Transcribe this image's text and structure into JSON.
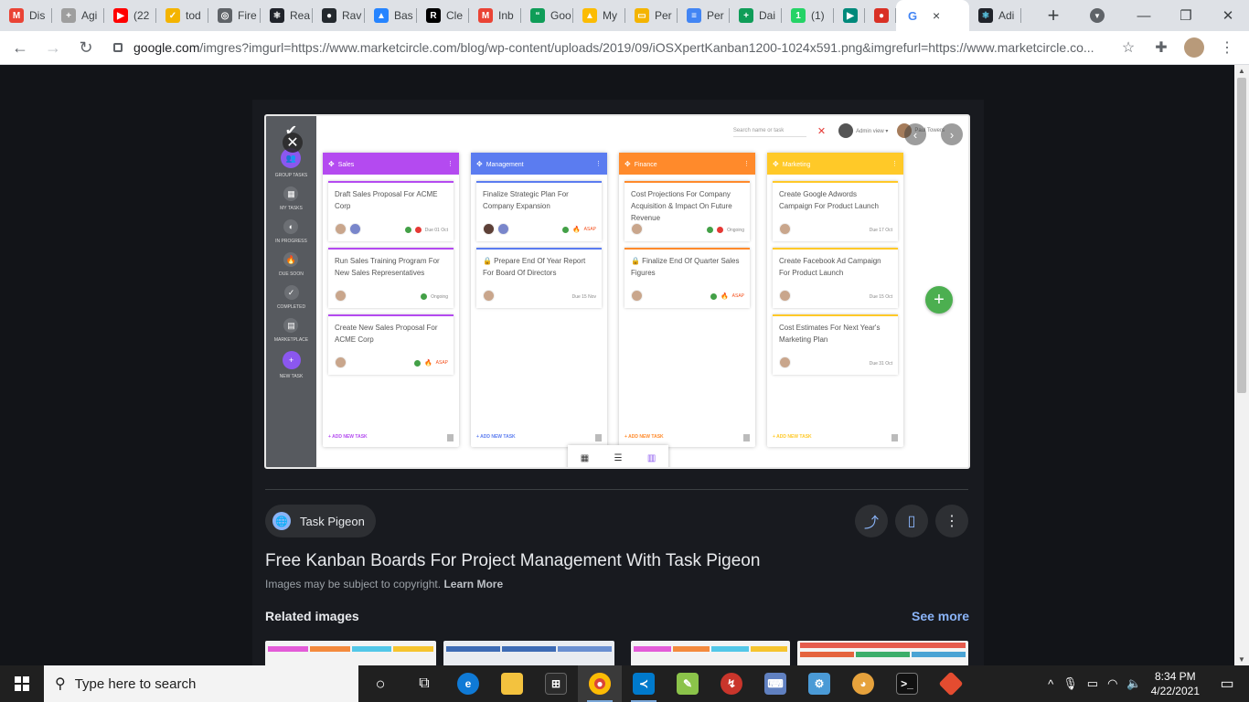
{
  "tabs": [
    {
      "label": "Dis",
      "icon": "gmail-icon",
      "color": "#ea4335",
      "glyph": "M"
    },
    {
      "label": "Agi",
      "icon": "agile-icon",
      "color": "#9e9e9e",
      "glyph": "+"
    },
    {
      "label": "(22",
      "icon": "youtube-icon",
      "color": "#ff0000",
      "glyph": "▶"
    },
    {
      "label": "tod",
      "icon": "todo-icon",
      "color": "#f4b400",
      "glyph": "✓"
    },
    {
      "label": "Fire",
      "icon": "globe-icon",
      "color": "#5f6368",
      "glyph": "◎"
    },
    {
      "label": "Rea",
      "icon": "react-icon",
      "color": "#20232a",
      "glyph": "⚛"
    },
    {
      "label": "Rav",
      "icon": "github-icon",
      "color": "#24292e",
      "glyph": "●"
    },
    {
      "label": "Bas",
      "icon": "atlassian-icon",
      "color": "#2684ff",
      "glyph": "▲"
    },
    {
      "label": "Cle",
      "icon": "replit-icon",
      "color": "#000000",
      "glyph": "R"
    },
    {
      "label": "Inb",
      "icon": "gmail-icon",
      "color": "#ea4335",
      "glyph": "M"
    },
    {
      "label": "Goo",
      "icon": "chat-icon",
      "color": "#0f9d58",
      "glyph": "“"
    },
    {
      "label": "My",
      "icon": "drive-icon",
      "color": "#fbbc04",
      "glyph": "▲"
    },
    {
      "label": "Per",
      "icon": "slides-icon",
      "color": "#f4b400",
      "glyph": "▭"
    },
    {
      "label": "Per",
      "icon": "docs-icon",
      "color": "#4285f4",
      "glyph": "≡"
    },
    {
      "label": "Dai",
      "icon": "sheets-icon",
      "color": "#0f9d58",
      "glyph": "+"
    },
    {
      "label": "(1)",
      "icon": "whatsapp-icon",
      "color": "#25d366",
      "glyph": "1"
    },
    {
      "label": "",
      "icon": "meet-icon",
      "color": "#00897b",
      "glyph": "▶"
    },
    {
      "label": "",
      "icon": "record-icon",
      "color": "#d93025",
      "glyph": "●"
    }
  ],
  "active_tab": {
    "label": "",
    "icon": "google-icon",
    "close": "×"
  },
  "last_tab": {
    "label": "Adi",
    "icon": "react-icon"
  },
  "address": {
    "host": "google.com",
    "path": "/imgres?imgurl=https://www.marketcircle.com/blog/wp-content/uploads/2019/09/iOSXpertKanban1200-1024x591.png&imgrefurl=https://www.marketcircle.co..."
  },
  "kanban": {
    "sidebar": [
      {
        "label": "GROUP TASKS",
        "glyph": "👥",
        "active": true
      },
      {
        "label": "MY TASKS",
        "glyph": "▦"
      },
      {
        "label": "IN PROGRESS",
        "glyph": "◐"
      },
      {
        "label": "DUE SOON",
        "glyph": "🔥"
      },
      {
        "label": "COMPLETED",
        "glyph": "✓"
      },
      {
        "label": "MARKETPLACE",
        "glyph": "▤"
      },
      {
        "label": "NEW TASK",
        "glyph": "+",
        "new": true
      }
    ],
    "search_placeholder": "Search name or task",
    "admin_view": "Admin view ▾",
    "user_name": "Paul Towers",
    "add_new_task": "+ ADD NEW TASK",
    "columns": [
      {
        "name": "Sales",
        "color": "#b44af0",
        "cards": [
          {
            "title": "Draft Sales Proposal For ACME Corp",
            "due": "Due 01 Oct",
            "status": "red"
          },
          {
            "title": "Run Sales Training Program For New Sales Representatives",
            "due": "Ongoing",
            "status": "green"
          },
          {
            "title": "Create New Sales Proposal For ACME Corp",
            "due": "ASAP",
            "status": "fire"
          }
        ]
      },
      {
        "name": "Management",
        "color": "#5b7cf0",
        "cards": [
          {
            "title": "Finalize Strategic Plan For Company Expansion",
            "due": "ASAP",
            "status": "fire"
          },
          {
            "title": "🔒 Prepare End Of Year Report For Board Of Directors",
            "due": "Due 15 Nov",
            "status": ""
          }
        ]
      },
      {
        "name": "Finance",
        "color": "#ff8a2b",
        "cards": [
          {
            "title": "Cost Projections For Company Acquisition & Impact On Future Revenue",
            "due": "Ongoing",
            "status": "red"
          },
          {
            "title": "🔒 Finalize End Of Quarter Sales Figures",
            "due": "ASAP",
            "status": "fire"
          }
        ]
      },
      {
        "name": "Marketing",
        "color": "#ffc928",
        "cards": [
          {
            "title": "Create Google Adwords Campaign For Product Launch",
            "due": "Due 17 Oct",
            "status": ""
          },
          {
            "title": "Create Facebook Ad Campaign For Product Launch",
            "due": "Due 15 Oct",
            "status": ""
          },
          {
            "title": "Cost Estimates For Next Year's Marketing Plan",
            "due": "Due 31 Oct",
            "status": ""
          }
        ]
      }
    ]
  },
  "source": {
    "name": "Task Pigeon"
  },
  "title": "Free Kanban Boards For Project Management With Task Pigeon",
  "copyright": "Images may be subject to copyright.",
  "learn_more": "Learn More",
  "related": "Related images",
  "see_more": "See more",
  "taskbar": {
    "search_placeholder": "Type here to search",
    "time": "8:34 PM",
    "date": "4/22/2021"
  }
}
